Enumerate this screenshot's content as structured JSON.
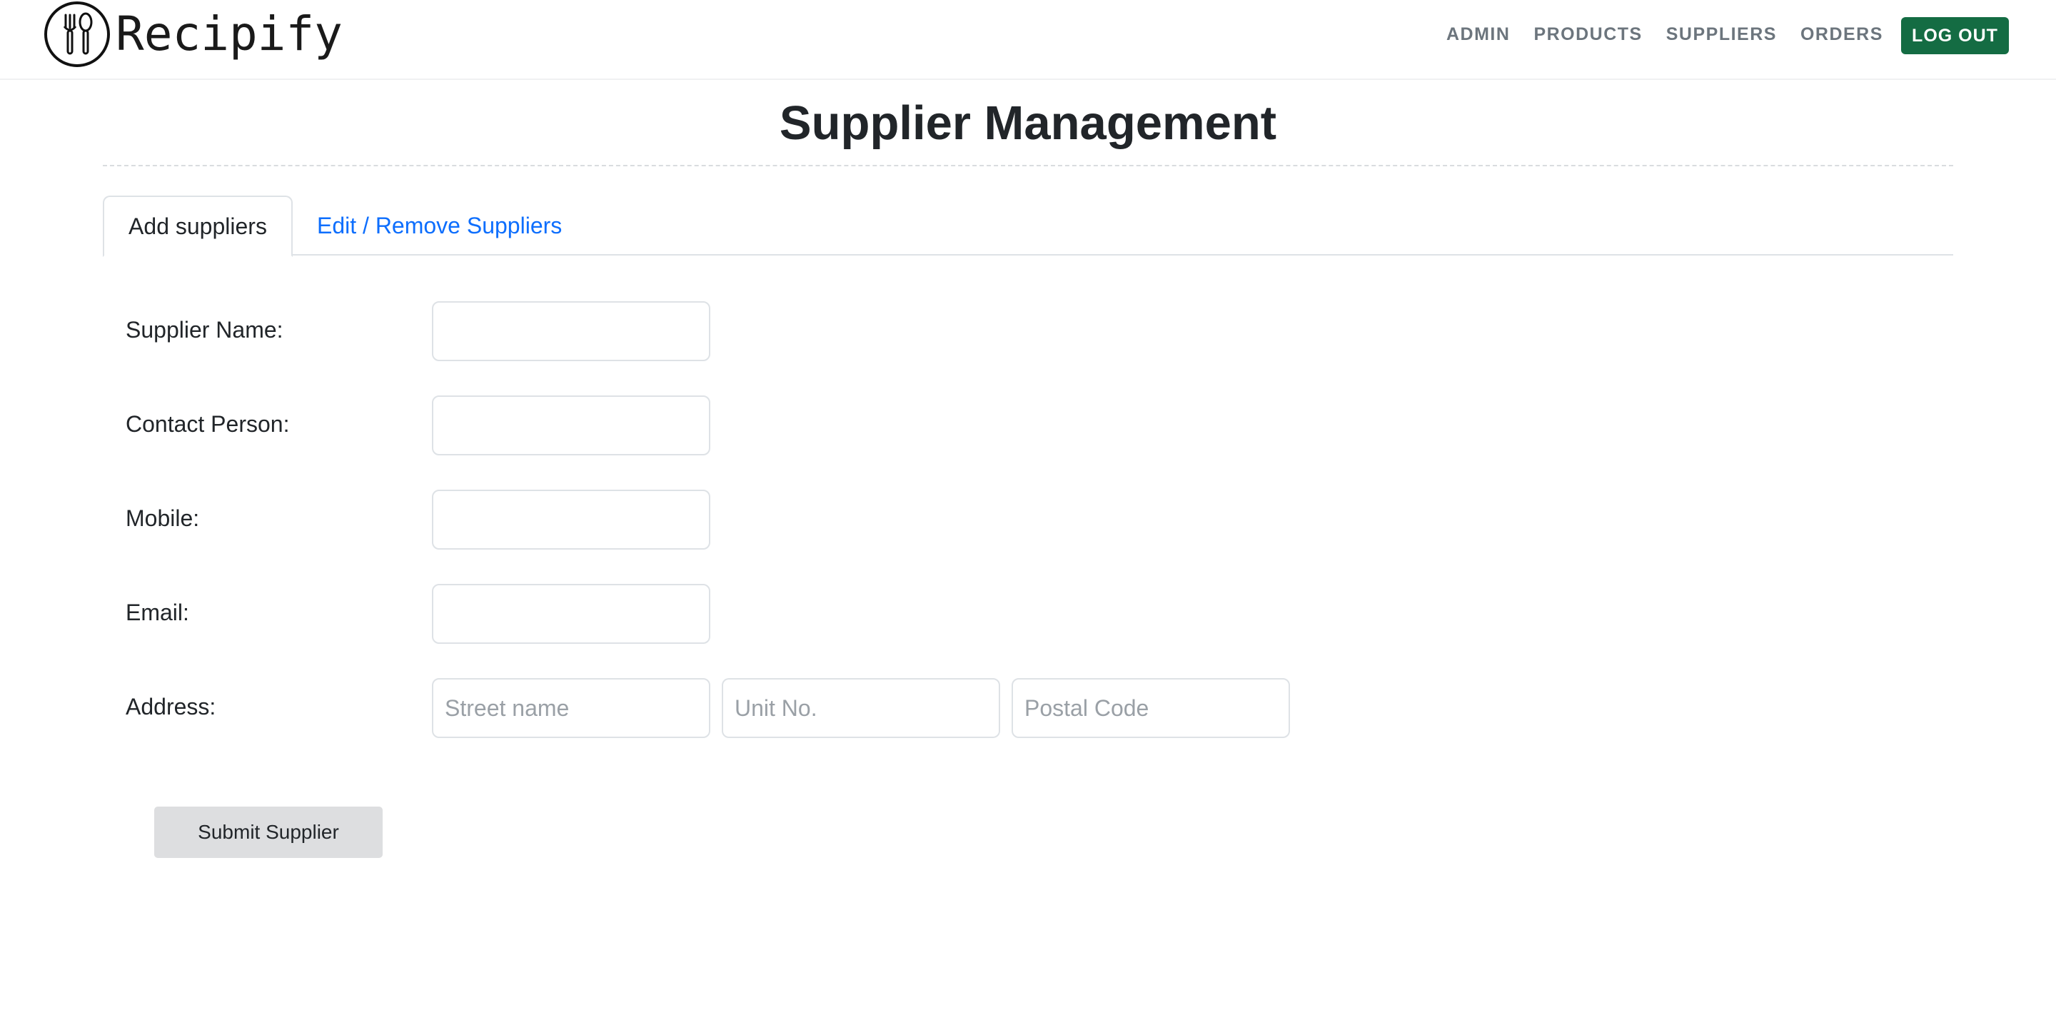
{
  "brand": {
    "name": "Recipify",
    "logo_icon": "fork-spoon-icon"
  },
  "nav": {
    "links": [
      "ADMIN",
      "PRODUCTS",
      "SUPPLIERS",
      "ORDERS"
    ],
    "logout_label": "LOG OUT",
    "logout_color": "#146c43"
  },
  "page": {
    "title": "Supplier Management"
  },
  "tabs": {
    "active": "Add suppliers",
    "other": "Edit / Remove Suppliers",
    "link_color": "#0d6efd"
  },
  "form": {
    "supplier_name": {
      "label": "Supplier Name:",
      "value": "",
      "placeholder": ""
    },
    "contact_person": {
      "label": "Contact Person:",
      "value": "",
      "placeholder": ""
    },
    "mobile": {
      "label": "Mobile:",
      "value": "",
      "placeholder": ""
    },
    "email": {
      "label": "Email:",
      "value": "",
      "placeholder": ""
    },
    "address": {
      "label": "Address:",
      "street_placeholder": "Street name",
      "unit_placeholder": "Unit No.",
      "postal_placeholder": "Postal Code"
    },
    "submit_label": "Submit Supplier"
  }
}
